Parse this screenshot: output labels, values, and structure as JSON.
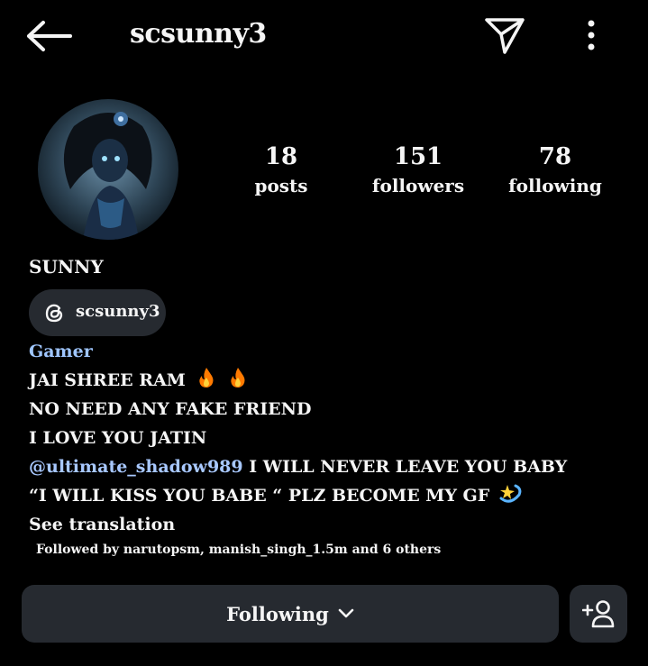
{
  "header": {
    "username": "scsunny3",
    "icons": [
      "arrow-left-icon",
      "paper-plane-icon",
      "more-vertical-icon"
    ]
  },
  "stats": [
    {
      "value": "18",
      "label": "posts"
    },
    {
      "value": "151",
      "label": "followers"
    },
    {
      "value": "78",
      "label": "following"
    }
  ],
  "profile": {
    "display_name": "SUNNY",
    "threads_handle": "scsunny3",
    "category": "Gamer",
    "bio_line1": "JAI SHREE RAM",
    "bio_line2": "NO NEED ANY FAKE FRIEND",
    "bio_line3": "I LOVE YOU JATIN",
    "bio_mention": "@ultimate_shadow989",
    "bio_line4_rest": " I WILL NEVER LEAVE YOU BABY",
    "bio_line5": "“I WILL KISS YOU BABE “ PLZ BECOME MY GF",
    "see_translation": "See translation",
    "followed_by": "Followed by narutopsm, manish_singh_1.5m and 6 others"
  },
  "actions": {
    "following_label": "Following"
  },
  "colors": {
    "background": "#000000",
    "button_bg": "#262a30",
    "link": "#a8c8ff"
  }
}
